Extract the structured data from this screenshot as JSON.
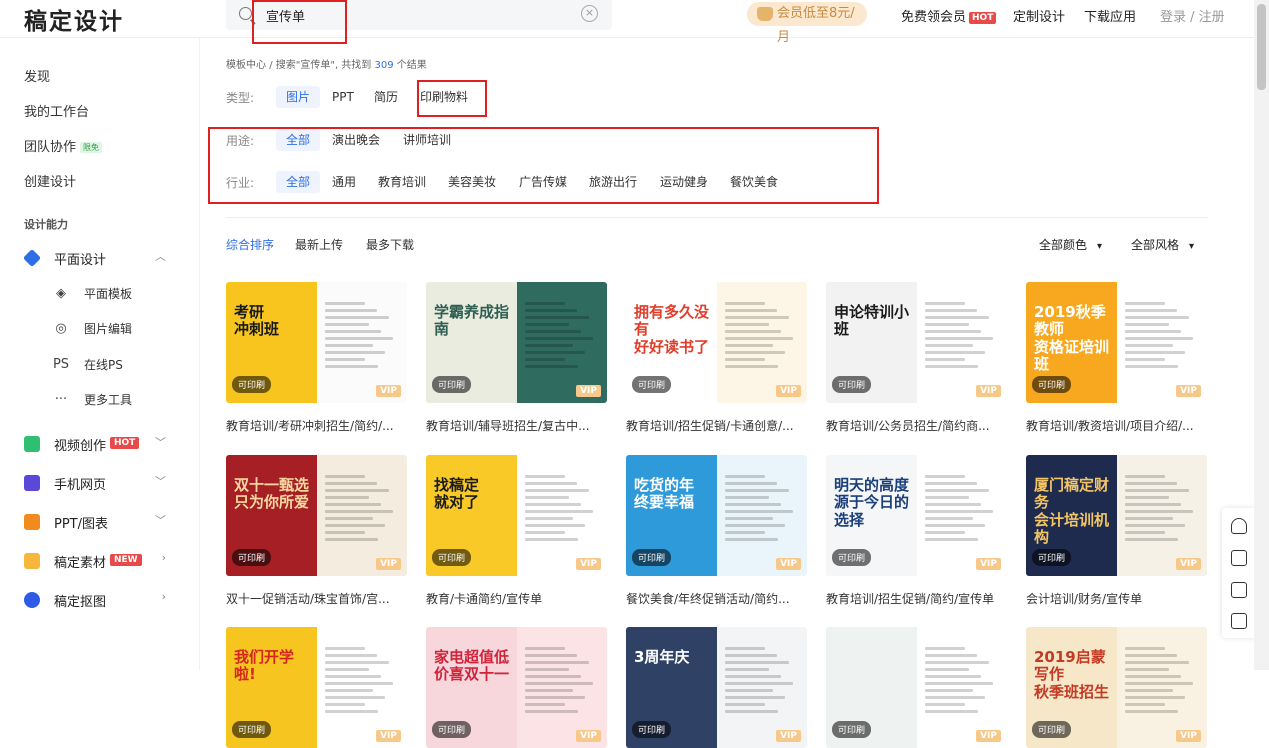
{
  "header": {
    "logo": "稿定设计",
    "search_value": "宣传单",
    "vip_promo": "会员低至8元/月",
    "free_vip": "免费领会员",
    "hot_badge": "HOT",
    "custom_design": "定制设计",
    "download_app": "下载应用",
    "login": "登录 / 注册"
  },
  "sidebar": {
    "discover": "发现",
    "workspace": "我的工作台",
    "team": "团队协作",
    "team_badge": "限免",
    "create": "创建设计",
    "section": "设计能力",
    "groups": [
      {
        "label": "平面设计",
        "color": "#2d6ee6"
      },
      {
        "label": "视频创作",
        "color": "#2fbf71",
        "badge": "HOT"
      },
      {
        "label": "手机网页",
        "color": "#5a48d8"
      },
      {
        "label": "PPT/图表",
        "color": "#f28b1e"
      },
      {
        "label": "稿定素材",
        "color": "#f6b73c",
        "badge": "NEW"
      },
      {
        "label": "稿定抠图",
        "color": "#2d5be6"
      }
    ],
    "subitems": [
      {
        "label": "平面模板",
        "icon": "layers-icon"
      },
      {
        "label": "图片编辑",
        "icon": "image-edit-icon"
      },
      {
        "label": "在线PS",
        "icon": "ps-icon",
        "glyph": "PS"
      },
      {
        "label": "更多工具",
        "icon": "more-icon",
        "glyph": "···"
      }
    ]
  },
  "breadcrumb": {
    "home": "模板中心",
    "sep": "/",
    "query_prefix": "搜索\"宣传单\", 共找到",
    "count": "309",
    "suffix": "个结果"
  },
  "filters": {
    "type_label": "类型:",
    "types": [
      "图片",
      "PPT",
      "简历",
      "印刷物料"
    ],
    "use_label": "用途:",
    "uses": [
      "全部",
      "演出晚会",
      "讲师培训"
    ],
    "industry_label": "行业:",
    "industries": [
      "全部",
      "通用",
      "教育培训",
      "美容美妆",
      "广告传媒",
      "旅游出行",
      "运动健身",
      "餐饮美食"
    ]
  },
  "sort": {
    "options": [
      "综合排序",
      "最新上传",
      "最多下载"
    ],
    "color_filter": "全部颜色",
    "style_filter": "全部风格"
  },
  "badges": {
    "printable": "可印刷",
    "vip": "VIP"
  },
  "cards": [
    {
      "caption": "教育培训/考研冲刺招生/简约/...",
      "title": "考研\n冲刺班",
      "left": "#f7c51e",
      "right": "#fbfbfb",
      "ink": "#1a1a1a"
    },
    {
      "caption": "教育培训/辅导班招生/复古中...",
      "title": "学霸养成指南",
      "left": "#e9ecdf",
      "right": "#2f6b5f",
      "ink": "#2f5e52"
    },
    {
      "caption": "教育培训/招生促销/卡通创意/...",
      "title": "拥有多久没有\n好好读书了",
      "left": "#ffffff",
      "right": "#fdf6e6",
      "ink": "#e23d2b"
    },
    {
      "caption": "教育培训/公务员招生/简约商...",
      "title": "申论特训小班",
      "left": "#f2f2f2",
      "right": "#ffffff",
      "ink": "#1a1a1a"
    },
    {
      "caption": "教育培训/教资培训/项目介绍/...",
      "title": "2019秋季教师\n资格证培训班",
      "left": "#f7a81e",
      "right": "#ffffff",
      "ink": "#ffffff"
    },
    {
      "caption": "双十一促销活动/珠宝首饰/宫...",
      "title": "双十一甄选\n只为你所爱",
      "left": "#a51f24",
      "right": "#f4ecdf",
      "ink": "#f8d9a2"
    },
    {
      "caption": "教育/卡通简约/宣传单",
      "title": "找稿定\n就对了",
      "left": "#f8c927",
      "right": "#ffffff",
      "ink": "#1a1a1a"
    },
    {
      "caption": "餐饮美食/年终促销活动/简约...",
      "title": "吃货的年\n终要幸福",
      "left": "#2f9ad9",
      "right": "#eaf5fb",
      "ink": "#ffffff"
    },
    {
      "caption": "教育培训/招生促销/简约/宣传单",
      "title": "明天的高度\n源于今日的选择",
      "left": "#f4f6f8",
      "right": "#ffffff",
      "ink": "#1c3f7a"
    },
    {
      "caption": "会计培训/财务/宣传单",
      "title": "厦门稿定财务\n会计培训机构",
      "left": "#1e2b4f",
      "right": "#f5f1e6",
      "ink": "#f3c565"
    },
    {
      "caption": "",
      "title": "我们开学啦!",
      "left": "#f6c51f",
      "right": "#ffffff",
      "ink": "#d3261f"
    },
    {
      "caption": "",
      "title": "家电超值低\n价喜双十一",
      "left": "#f7d6dc",
      "right": "#fbe3e6",
      "ink": "#d1233a"
    },
    {
      "caption": "",
      "title": "3周年庆",
      "left": "#2f4266",
      "right": "#f3f4f6",
      "ink": "#ffffff"
    },
    {
      "caption": "",
      "title": "",
      "left": "#eef2f0",
      "right": "#ffffff",
      "ink": "#1a1a1a"
    },
    {
      "caption": "",
      "title": "2019启蒙写作\n秋季班招生",
      "left": "#f6e7c8",
      "right": "#f9f1e1",
      "ink": "#c43a24"
    }
  ],
  "colors": {
    "accent": "#2d6ee6",
    "highlight_box": "#e02020"
  }
}
